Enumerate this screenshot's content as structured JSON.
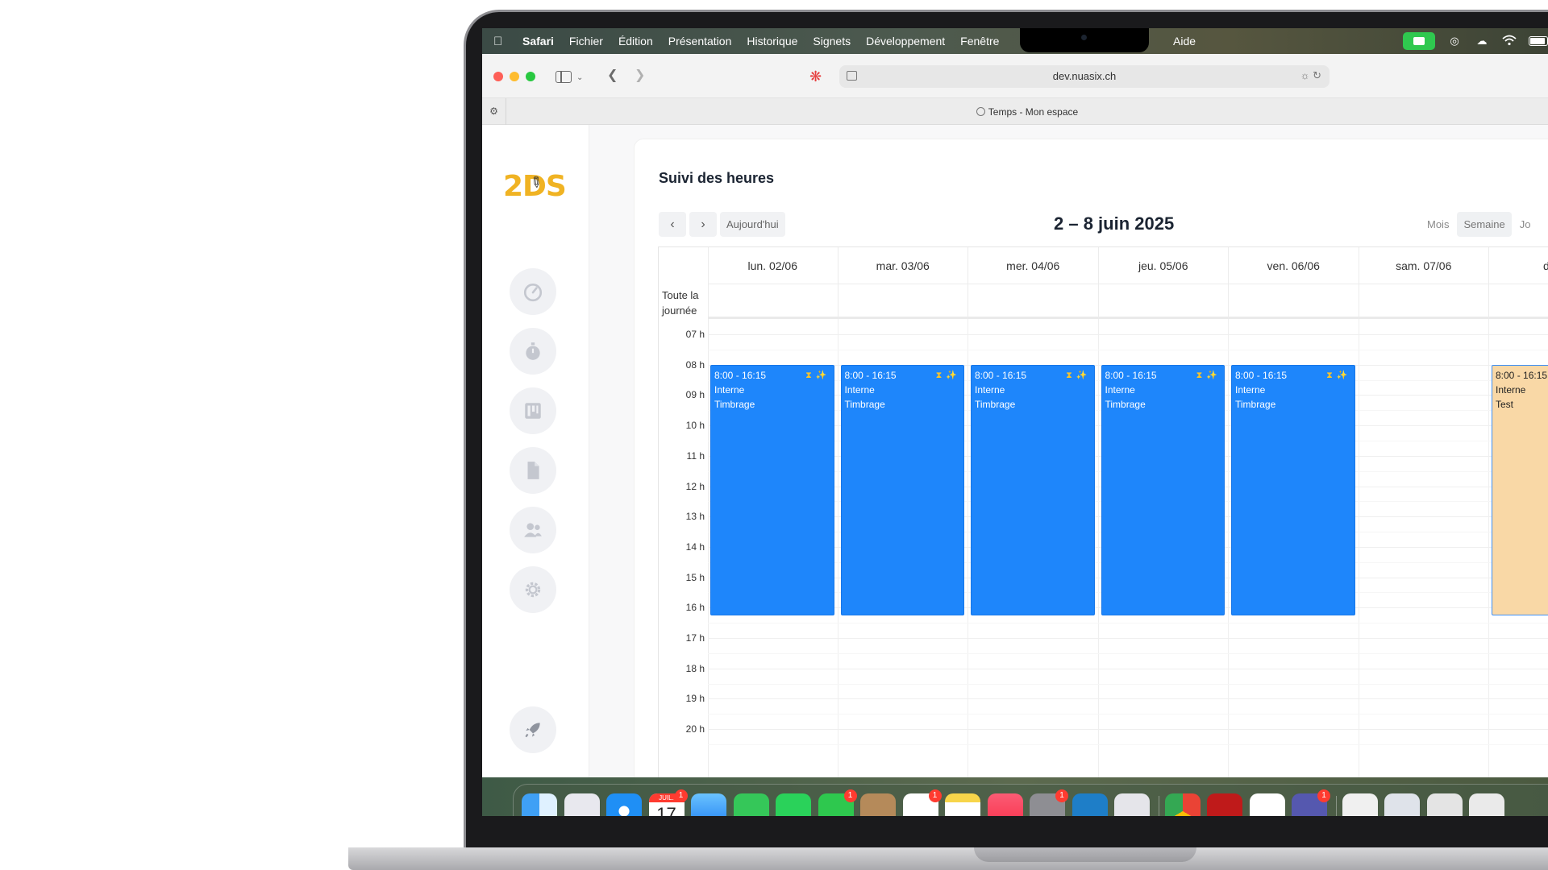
{
  "menubar": {
    "app": "Safari",
    "items": [
      "Fichier",
      "Édition",
      "Présentation",
      "Historique",
      "Signets",
      "Développement",
      "Fenêtre"
    ],
    "aide": "Aide"
  },
  "browser": {
    "url": "dev.nuasix.ch",
    "tab_title": "Temps - Mon espace"
  },
  "app": {
    "logo": "2DS",
    "nav": [
      "dashboard-icon",
      "stopwatch-icon",
      "board-icon",
      "document-icon",
      "users-icon",
      "settings-icon",
      "rocket-icon"
    ]
  },
  "calendar": {
    "title": "Suivi des heures",
    "today_label": "Aujourd'hui",
    "range": "2 – 8 juin 2025",
    "views": [
      "Mois",
      "Semaine",
      "Jo"
    ],
    "active_view": "Semaine",
    "allday_label_1": "Toute la",
    "allday_label_2": "journée",
    "days": [
      "lun. 02/06",
      "mar. 03/06",
      "mer. 04/06",
      "jeu. 05/06",
      "ven. 06/06",
      "sam. 07/06",
      "dim."
    ],
    "hours": [
      "07 h",
      "08 h",
      "09 h",
      "10 h",
      "11 h",
      "12 h",
      "13 h",
      "14 h",
      "15 h",
      "16 h",
      "17 h",
      "18 h",
      "19 h",
      "20 h"
    ],
    "events": [
      {
        "day": 0,
        "time": "8:00 - 16:15",
        "line1": "Interne",
        "line2": "Timbrage",
        "color": "#1e86fb"
      },
      {
        "day": 1,
        "time": "8:00 - 16:15",
        "line1": "Interne",
        "line2": "Timbrage",
        "color": "#1e86fb"
      },
      {
        "day": 2,
        "time": "8:00 - 16:15",
        "line1": "Interne",
        "line2": "Timbrage",
        "color": "#1e86fb"
      },
      {
        "day": 3,
        "time": "8:00 - 16:15",
        "line1": "Interne",
        "line2": "Timbrage",
        "color": "#1e86fb"
      },
      {
        "day": 4,
        "time": "8:00 - 16:15",
        "line1": "Interne",
        "line2": "Timbrage",
        "color": "#1e86fb"
      },
      {
        "day": 6,
        "time": "8:00 - 16:15",
        "line1": "Interne",
        "line2": "Test",
        "color": "#f9d8a6"
      }
    ]
  },
  "dock": {
    "calendar_month": "JUIL.",
    "calendar_day": "17",
    "badge": "1"
  }
}
